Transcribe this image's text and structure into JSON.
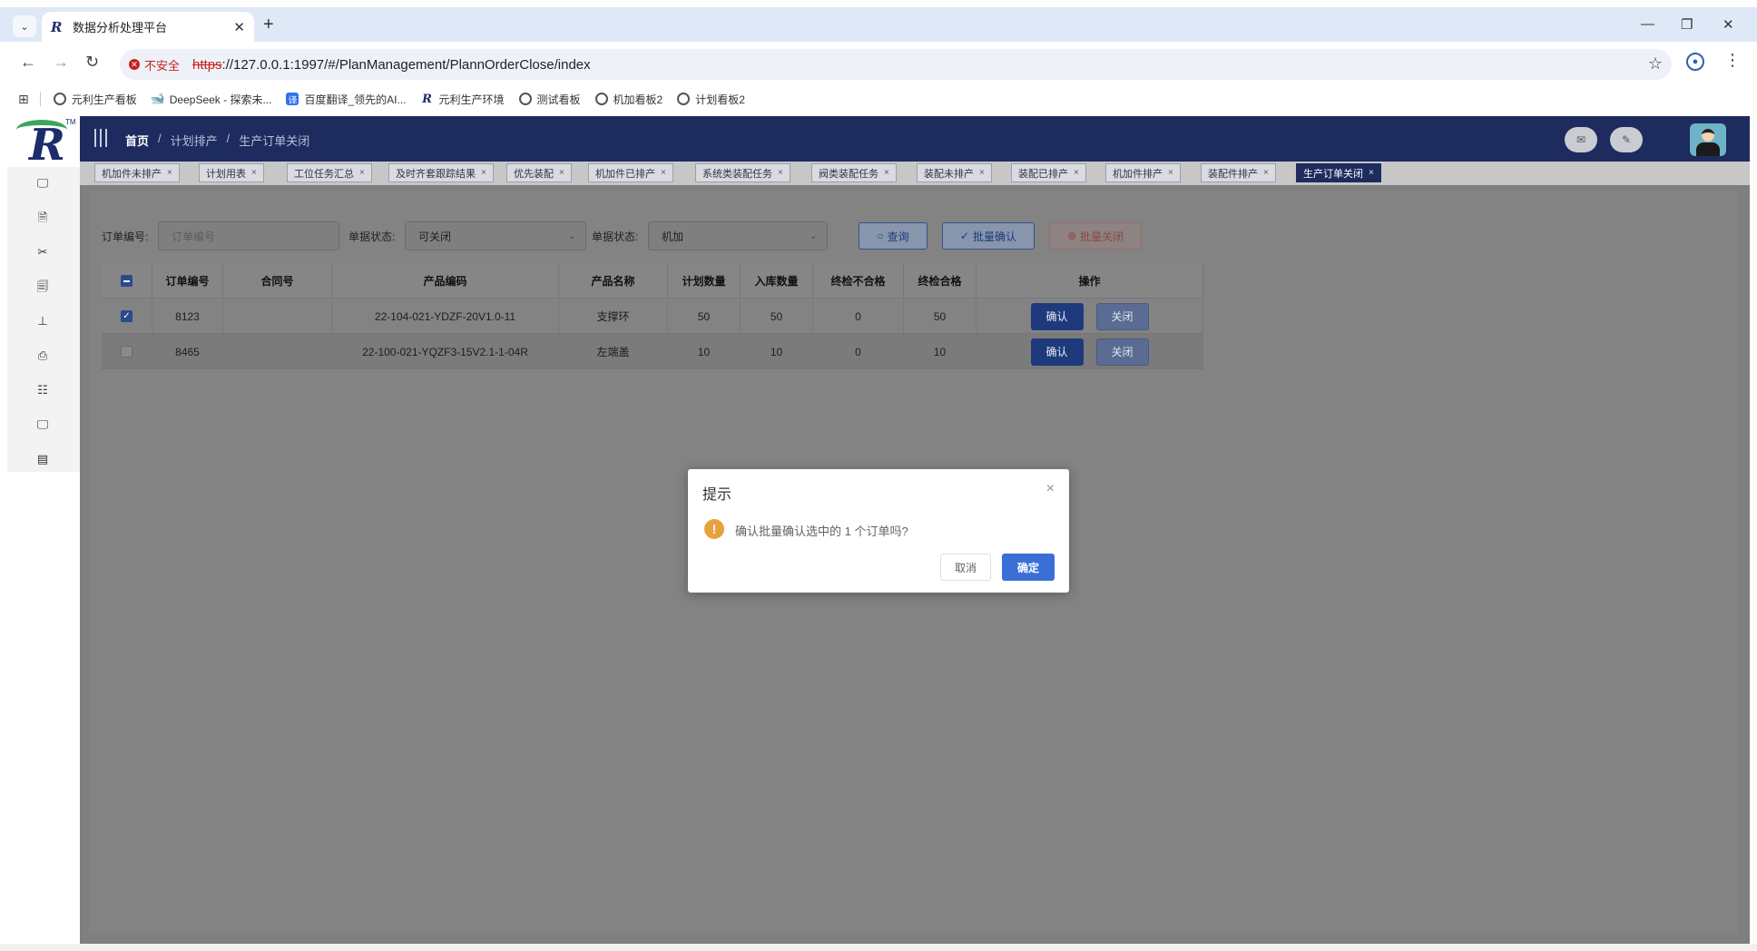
{
  "browser": {
    "tab_title": "数据分析处理平台",
    "tab_favicon": "R",
    "dropdown_glyph": "⌄",
    "close_glyph": "✕",
    "new_tab_glyph": "+",
    "minimize_glyph": "—",
    "restore_glyph": "❐",
    "window_close_glyph": "✕",
    "back_glyph": "←",
    "forward_glyph": "→",
    "reload_glyph": "↻",
    "insecure_label": "不安全",
    "url_scheme": "https",
    "url_rest": "://127.0.0.1:1997/#/PlanManagement/PlannOrderClose/index",
    "star_glyph": "☆",
    "menu_glyph": "⋮",
    "apps_glyph": "⊞",
    "bookmarks": [
      {
        "label": "元利生产看板",
        "icon": "globe-icon",
        "glyph": ""
      },
      {
        "label": "DeepSeek - 探索未...",
        "icon": "deepseek-icon",
        "glyph": "🐋"
      },
      {
        "label": "百度翻译_领先的AI...",
        "icon": "translate-icon",
        "glyph": "译"
      },
      {
        "label": "元利生产环境",
        "icon": "app-logo-icon",
        "glyph": "R"
      },
      {
        "label": "测试看板",
        "icon": "globe-icon",
        "glyph": ""
      },
      {
        "label": "机加看板2",
        "icon": "globe-icon",
        "glyph": ""
      },
      {
        "label": "计划看板2",
        "icon": "globe-icon",
        "glyph": ""
      }
    ]
  },
  "app": {
    "logo_letter": "R",
    "logo_tm": "TM",
    "breadcrumb": [
      "首页",
      "计划排产",
      "生产订单关闭"
    ],
    "breadcrumb_sep": "/",
    "topbar_icons": [
      "✉",
      "✎"
    ],
    "tags": [
      {
        "label": "机加件未排产",
        "active": false
      },
      {
        "label": "计划用表",
        "active": false
      },
      {
        "label": "工位任务汇总",
        "active": false
      },
      {
        "label": "及时齐套跟踪结果",
        "active": false
      },
      {
        "label": "优先装配",
        "active": false
      },
      {
        "label": "机加件已排产",
        "active": false
      },
      {
        "label": "系统类装配任务",
        "active": false
      },
      {
        "label": "阀类装配任务",
        "active": false
      },
      {
        "label": "装配未排产",
        "active": false
      },
      {
        "label": "装配已排产",
        "active": false
      },
      {
        "label": "机加件排产",
        "active": false
      },
      {
        "label": "装配件排产",
        "active": false
      },
      {
        "label": "生产订单关闭",
        "active": true
      }
    ],
    "tag_close_glyph": "×",
    "sidebar_icons": [
      {
        "name": "monitor-icon",
        "glyph": "🖵"
      },
      {
        "name": "document-edit-icon",
        "glyph": "🗎"
      },
      {
        "name": "tools-icon",
        "glyph": "✂"
      },
      {
        "name": "report-icon",
        "glyph": "🗐"
      },
      {
        "name": "stamp-icon",
        "glyph": "⊥"
      },
      {
        "name": "printer-icon",
        "glyph": "⎙"
      },
      {
        "name": "checklist-icon",
        "glyph": "☷"
      },
      {
        "name": "display-icon",
        "glyph": "🖵"
      },
      {
        "name": "calendar-icon",
        "glyph": "▤"
      }
    ]
  },
  "filters": {
    "order_no_label": "订单编号:",
    "order_no_placeholder": "订单编号",
    "status_label": "单据状态:",
    "status_value": "可关闭",
    "status2_label": "单据状态:",
    "status2_value": "机加",
    "caret": "⌄",
    "query_label": "查询",
    "query_icon": "○",
    "batch_confirm_label": "批量确认",
    "batch_confirm_icon": "✓",
    "batch_close_label": "批量关闭",
    "batch_close_icon": "⊗"
  },
  "table": {
    "columns": [
      "订单编号",
      "合同号",
      "产品编码",
      "产品名称",
      "计划数量",
      "入库数量",
      "终检不合格",
      "终检合格",
      "操作"
    ],
    "rows": [
      {
        "checked": true,
        "order_no": "8123",
        "contract": "",
        "product_code": "22-104-021-YDZF-20V1.0-11",
        "product_name": "支撑环",
        "plan_qty": "50",
        "stock_qty": "50",
        "fail_qty": "0",
        "pass_qty": "50",
        "confirm": "确认",
        "close": "关闭"
      },
      {
        "checked": false,
        "order_no": "8465",
        "contract": "",
        "product_code": "22-100-021-YQZF3-15V2.1-1-04R",
        "product_name": "左端盖",
        "plan_qty": "10",
        "stock_qty": "10",
        "fail_qty": "0",
        "pass_qty": "10",
        "confirm": "确认",
        "close": "关闭"
      }
    ],
    "check_glyph": "✓"
  },
  "dialog": {
    "title": "提示",
    "close_glyph": "×",
    "warn_glyph": "!",
    "message": "确认批量确认选中的 1 个订单吗?",
    "cancel_label": "取消",
    "ok_label": "确定"
  },
  "colors": {
    "topbar": "#1e2b5e",
    "active_tag": "#1e2b5e",
    "primary_button": "#3a6fd8",
    "warning": "#e6a23c",
    "insecure": "#c5221f"
  }
}
